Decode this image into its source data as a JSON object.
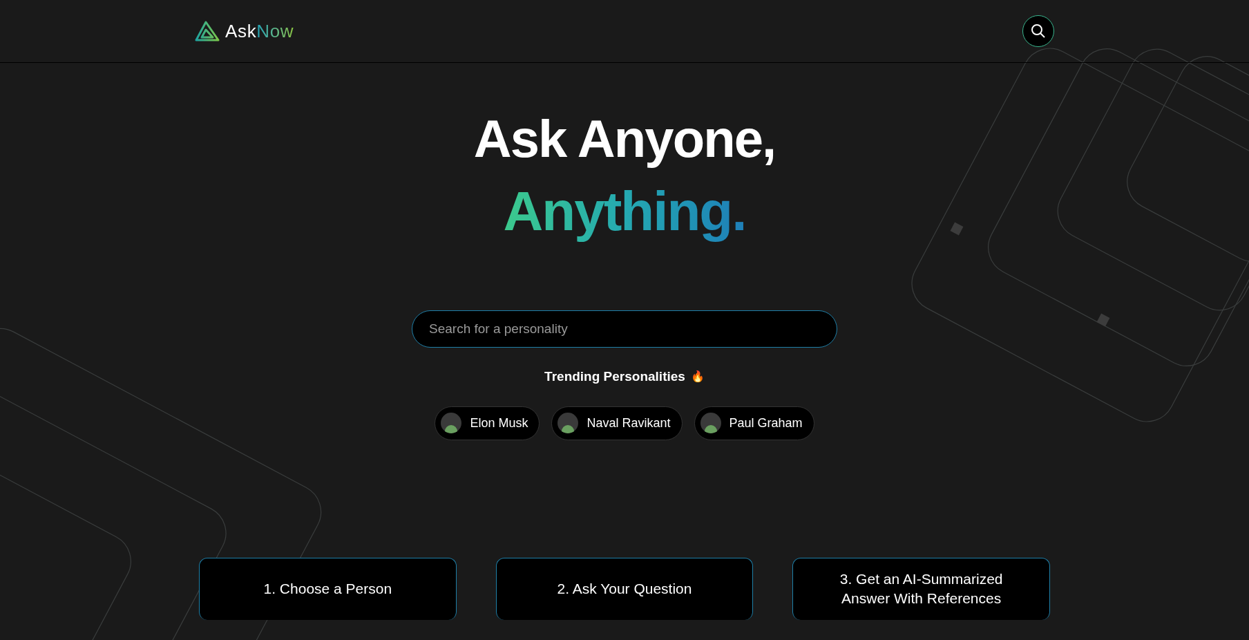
{
  "header": {
    "logo": {
      "plain": "Ask",
      "accent": "Now"
    }
  },
  "hero": {
    "title_line": "Ask Anyone,",
    "accent_line": "Anything."
  },
  "search": {
    "placeholder": "Search for a personality"
  },
  "trending": {
    "heading": "Trending Personalities",
    "emoji": "🔥",
    "people": [
      {
        "name": "Elon Musk"
      },
      {
        "name": "Naval Ravikant"
      },
      {
        "name": "Paul Graham"
      }
    ]
  },
  "steps": [
    "1. Choose a Person",
    "2. Ask Your Question",
    "3. Get an AI-Summarized Answer With References"
  ]
}
